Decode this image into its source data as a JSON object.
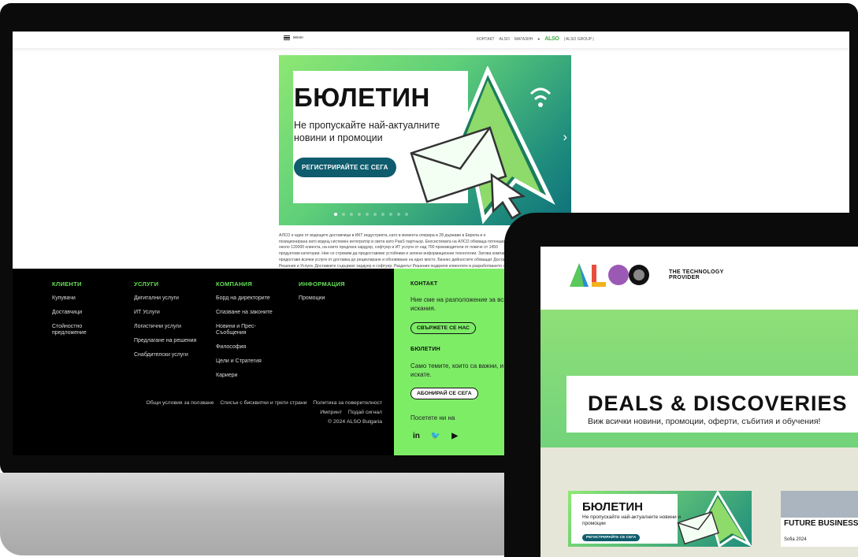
{
  "topbar": {
    "menu": "меню",
    "links": [
      "КОНТАКТ",
      "ALSO",
      "МАГАЗИН"
    ],
    "brand": "ALSO",
    "group": "| ALSO GROUP |"
  },
  "slider": {
    "title": "БЮЛЕТИН",
    "subtitle": "Не пропускайте най-актуалните новини и промоции",
    "cta": "РЕГИСТРИРАЙТЕ СЕ СЕГА",
    "next": "›",
    "dots_total": 10,
    "active_dot": 0
  },
  "about": "АЛСО е един от водещите доставчици в ИКТ индустрията, като в момента оперира в 28 държави в Европа и е позиционирана като водещ системен интегратор в света като PaaS партньор. Екосистемата на АЛСО обхваща потенциала на около 120000 клиента, на които предлага хардуер, софтуер и ИТ услуги от над 700 производители от повече от 1450 продуктови категории. Ние се стремим да предоставяме устойчиви и зелени информационни технологии. Затова компанията предоставя всички услуги от доставка до рециклиране и обновяване на едно място. Бизнес дейностите обхващат Доставки, Решения и Услуги. Доставките съдържат хардуер и софтуер. Разделът Решения подкрепя клиентите в разработването на персонализирани ИТ решения.",
  "footer": {
    "columns": [
      {
        "heading": "КЛИЕНТИ",
        "links": [
          "Купувачи",
          "Доставчици",
          "Стойностно предложение"
        ]
      },
      {
        "heading": "УСЛУГИ",
        "links": [
          "Дигитални услуги",
          "ИТ Услуги",
          "Логистични услуги",
          "Предлагане на решения",
          "Снабдителски услуги"
        ]
      },
      {
        "heading": "КОМПАНИЯ",
        "links": [
          "Борд на директорите",
          "Спазване на законите",
          "Новини и Прес-Съобщения",
          "Философия",
          "Цели и Стратегия",
          "Кариери"
        ]
      },
      {
        "heading": "ИНФОРМАЦИЯ",
        "links": [
          "Промоции"
        ]
      }
    ],
    "legal": [
      "Общи условия за ползване",
      "Списък с бисквитки и трети страни",
      "Политика за поверителност",
      "Импринт",
      "Подай сигнал"
    ],
    "copyright": "© 2024 ALSO Bulgaria"
  },
  "contact": {
    "heading": "КОНТАКТ",
    "text": "Ние сме на разположение за всякакви въпроси и искания.",
    "button": "СВЪРЖЕТЕ СЕ НАС",
    "newsletter_heading": "БЮЛЕТИН",
    "newsletter_text": "Само темите, които са важни, и само когато ги искате.",
    "subscribe": "АБОНИРАЙ СЕ СЕГА",
    "visit": "Посетете ни на",
    "social": [
      "in",
      "🐦",
      "▶"
    ]
  },
  "tablet": {
    "tagline": "THE TECHNOLOGY PROVIDER",
    "banner_title": "DEALS & DISCOVERIES",
    "banner_sub": "Виж всички новини, промоции, оферти, събития и обучения!",
    "card1": {
      "title": "БЮЛЕТИН",
      "subtitle": "Не пропускайте най-актуалните новини и промоции",
      "cta": "РЕГИСТРИРАЙТЕ СЕ СЕГА"
    },
    "card2": {
      "title": "FUTURE BUSINESS",
      "subtitle": "Sofia 2024"
    }
  }
}
